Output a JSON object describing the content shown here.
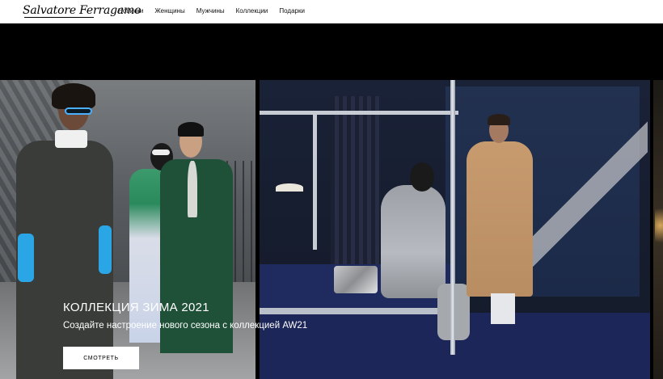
{
  "header": {
    "logo_text": "Salvatore Ferragamo",
    "nav": [
      {
        "label": "Новинки"
      },
      {
        "label": "Женщины"
      },
      {
        "label": "Мужчины"
      },
      {
        "label": "Коллекции"
      },
      {
        "label": "Подарки"
      }
    ]
  },
  "hero": {
    "title": "КОЛЛЕКЦИЯ ЗИМА 2021",
    "subtitle": "Создайте настроение нового сезона с коллекцией AW21",
    "cta_label": "СМОТРЕТЬ"
  },
  "colors": {
    "header_bg": "#ffffff",
    "page_bg": "#000000",
    "text_light": "#ffffff",
    "button_bg": "#ffffff"
  }
}
